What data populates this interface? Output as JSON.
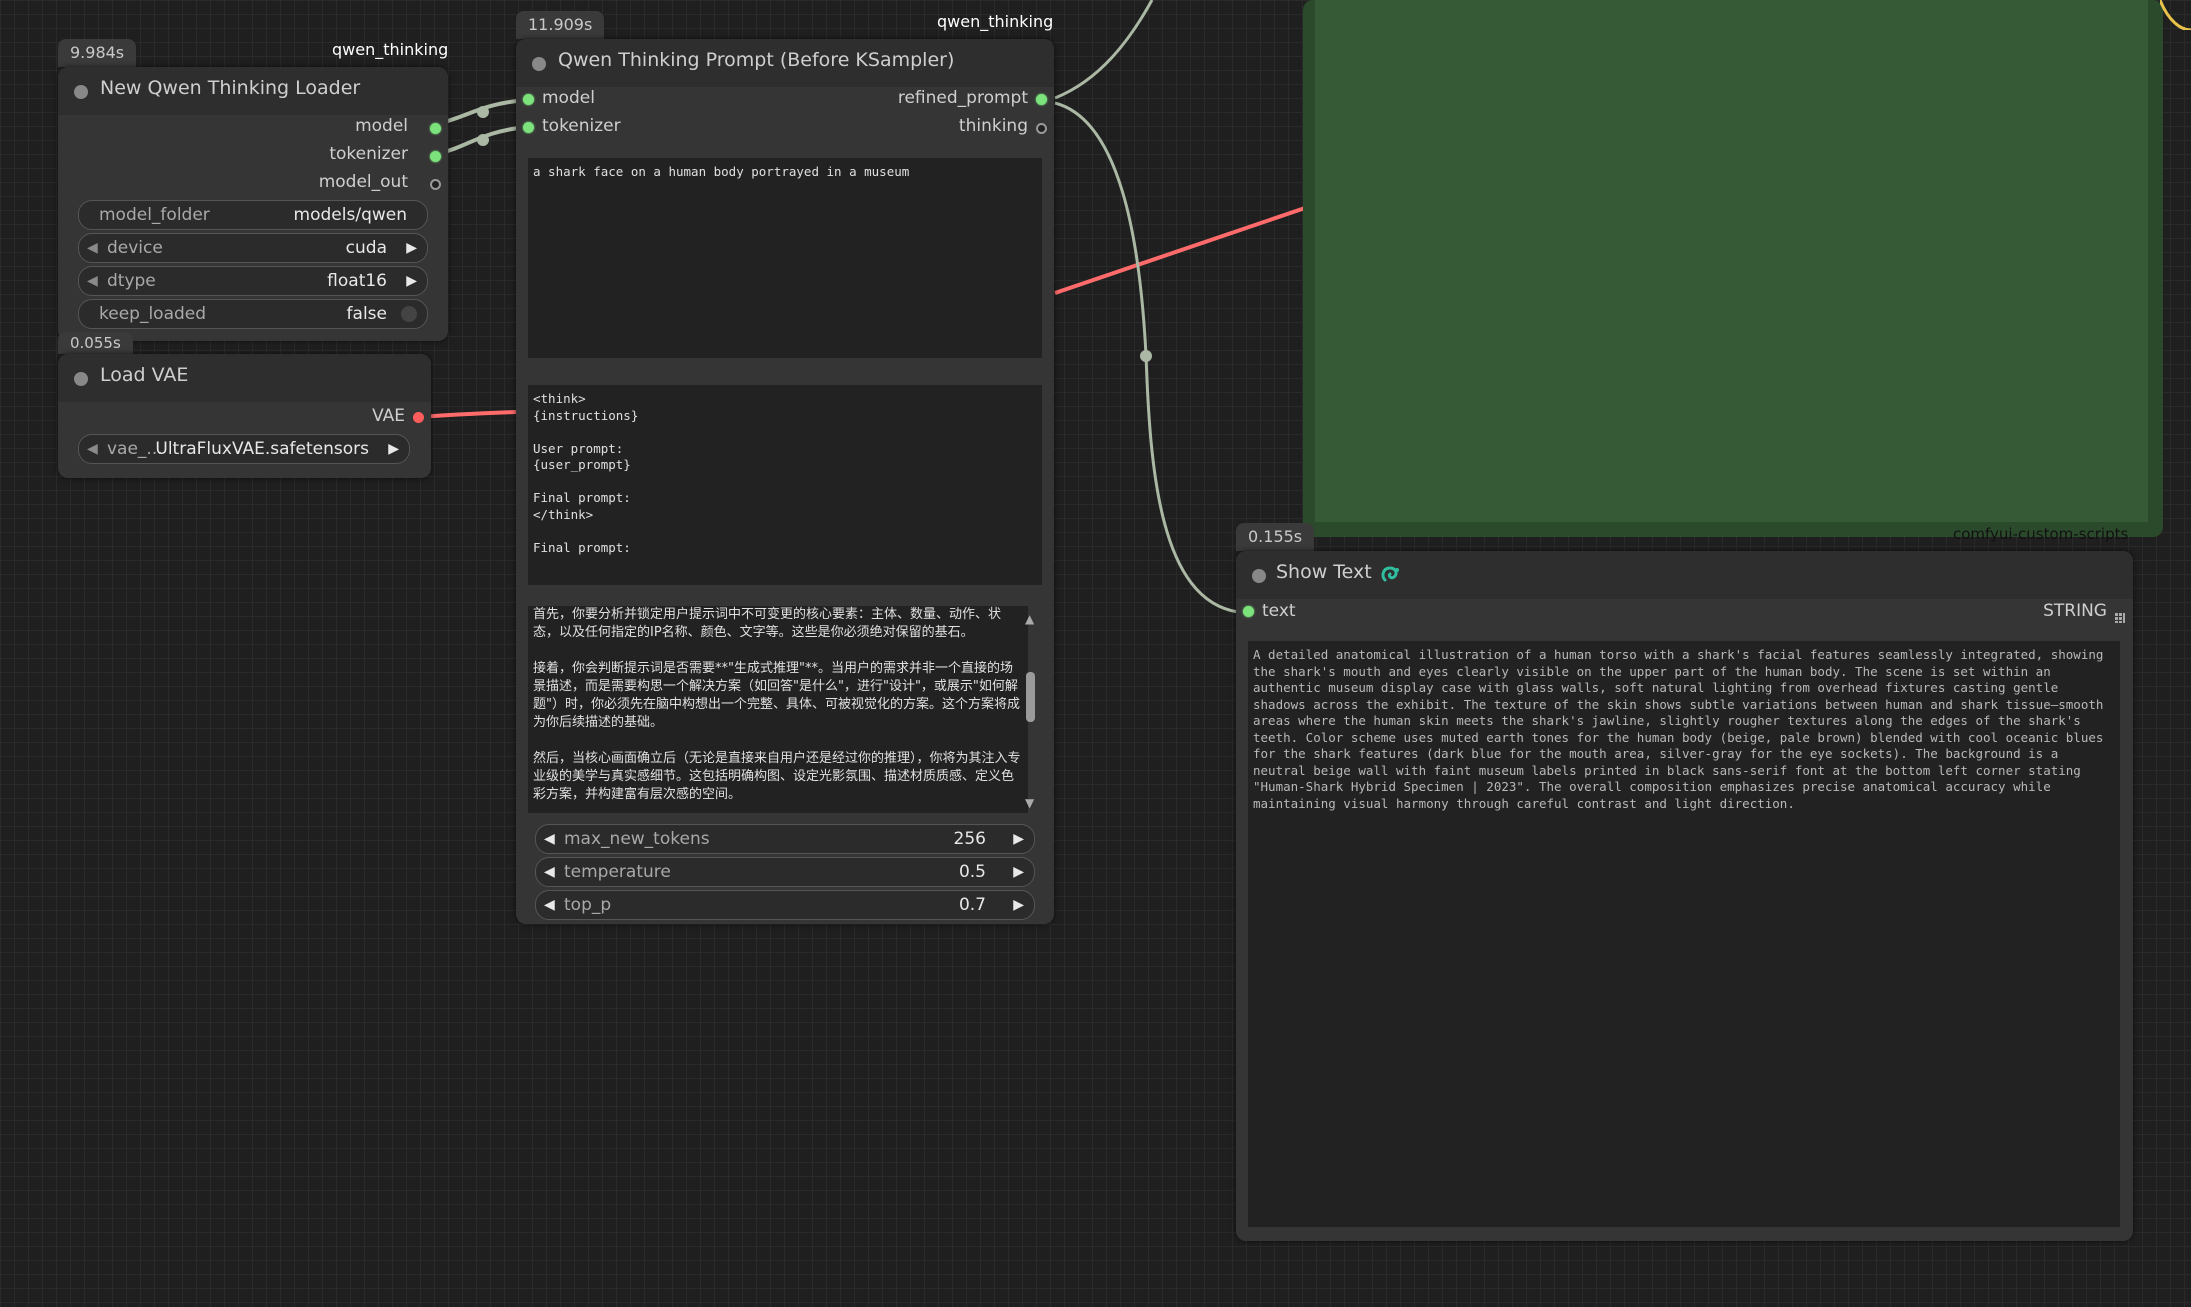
{
  "colors": {
    "canvas": "#1f1f1f",
    "node_bg": "#353535",
    "wire_model": "#aab8a4",
    "wire_vae": "#ff6b6b",
    "socket_green": "#7ce37c",
    "group_green": "#2b4a2b"
  },
  "loader": {
    "time": "9.984s",
    "tag": "qwen_thinking",
    "title": "New Qwen Thinking Loader",
    "outputs": [
      "model",
      "tokenizer",
      "model_out"
    ],
    "widgets": {
      "model_folder": {
        "label": "model_folder",
        "value": "models/qwen"
      },
      "device": {
        "label": "device",
        "value": "cuda"
      },
      "dtype": {
        "label": "dtype",
        "value": "float16"
      },
      "keep_loaded": {
        "label": "keep_loaded",
        "value": "false"
      }
    }
  },
  "vae": {
    "time": "0.055s",
    "title": "Load VAE",
    "output": "VAE",
    "widget": {
      "label": "vae_...",
      "value": "UltraFluxVAE.safetensors"
    }
  },
  "prompt_node": {
    "time": "11.909s",
    "tag": "qwen_thinking",
    "title": "Qwen Thinking Prompt (Before KSampler)",
    "inputs": [
      "model",
      "tokenizer"
    ],
    "outputs": [
      "refined_prompt",
      "thinking"
    ],
    "user_prompt": "a shark face on a human body portrayed in a museum",
    "template": "<think>\n{instructions}\n\nUser prompt:\n{user_prompt}\n\nFinal prompt:\n</think>\n\nFinal prompt:",
    "instructions": "首先，你要分析并锁定用户提示词中不可变更的核心要素：主体、数量、动作、状态，以及任何指定的IP名称、颜色、文字等。这些是你必须绝对保留的基石。\n\n接着，你会判断提示词是否需要**\"生成式推理\"**。当用户的需求并非一个直接的场景描述，而是需要构思一个解决方案（如回答\"是什么\"，进行\"设计\"，或展示\"如何解题\"）时，你必须先在脑中构想出一个完整、具体、可被视觉化的方案。这个方案将成为你后续描述的基础。\n\n然后，当核心画面确立后（无论是直接来自用户还是经过你的推理），你将为其注入专业级的美学与真实感细节。这包括明确构图、设定光影氛围、描述材质质感、定义色彩方案，并构建富有层次感的空间。",
    "sliders": [
      {
        "label": "max_new_tokens",
        "value": "256"
      },
      {
        "label": "temperature",
        "value": "0.5"
      },
      {
        "label": "top_p",
        "value": "0.7"
      }
    ]
  },
  "show_text": {
    "time": "0.155s",
    "group_label": "comfyui-custom-scripts",
    "title": "Show Text",
    "input": "text",
    "output_type": "STRING",
    "content": "A detailed anatomical illustration of a human torso with a shark's facial features seamlessly integrated, showing the shark's mouth and eyes clearly visible on the upper part of the human body. The scene is set within an authentic museum display case with glass walls, soft natural lighting from overhead fixtures casting gentle shadows across the exhibit. The texture of the skin shows subtle variations between human and shark tissue—smooth areas where the human skin meets the shark's jawline, slightly rougher textures along the edges of the shark's teeth. Color scheme uses muted earth tones for the human body (beige, pale brown) blended with cool oceanic blues for the shark features (dark blue for the mouth area, silver-gray for the eye sockets). The background is a neutral beige wall with faint museum labels printed in black sans-serif font at the bottom left corner stating \"Human-Shark Hybrid Specimen | 2023\". The overall composition emphasizes precise anatomical accuracy while maintaining visual harmony through careful contrast and light direction."
  }
}
